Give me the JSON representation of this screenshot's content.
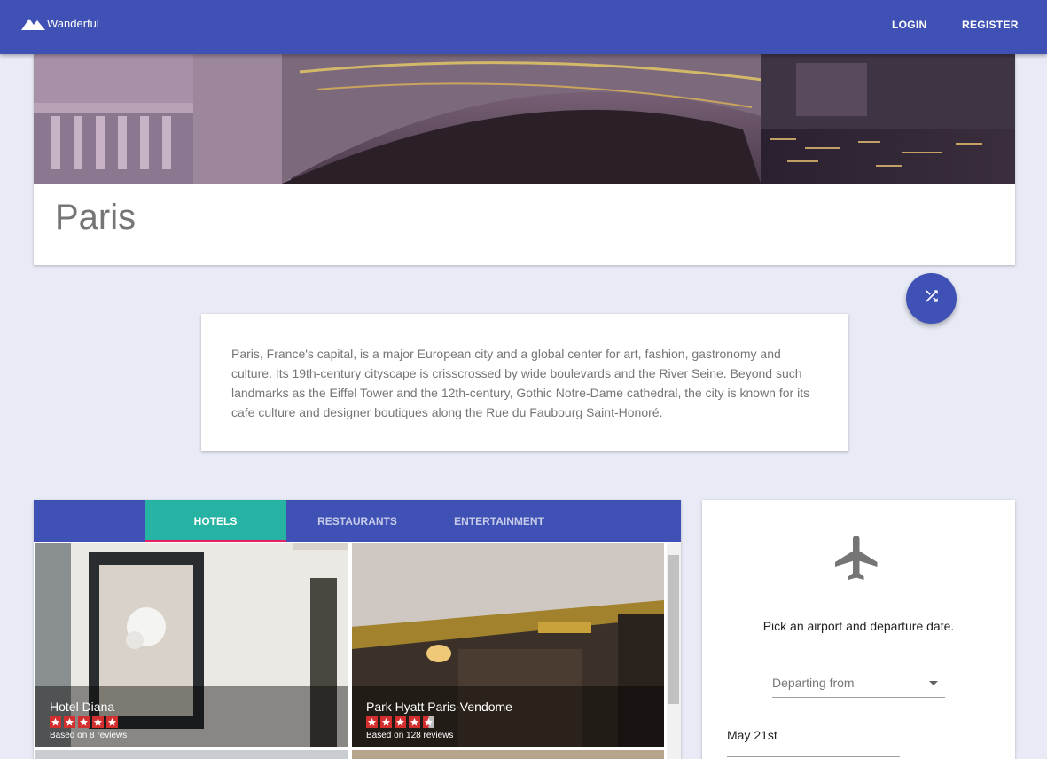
{
  "app": {
    "name": "Wanderful",
    "logo_icon": "mountain-icon"
  },
  "nav": {
    "login": "LOGIN",
    "register": "REGISTER"
  },
  "city": {
    "name": "Paris"
  },
  "shuffle_icon": "shuffle-icon",
  "description": "Paris, France's capital, is a major European city and a global center for art, fashion, gastronomy and culture. Its 19th-century cityscape is crisscrossed by wide boulevards and the River Seine. Beyond such landmarks as the Eiffel Tower and the 12th-century, Gothic Notre-Dame cathedral, the city is known for its cafe culture and designer boutiques along the Rue du Faubourg Saint-Honoré.",
  "tabs": [
    {
      "label": "HOTELS",
      "active": true
    },
    {
      "label": "RESTAURANTS",
      "active": false
    },
    {
      "label": "ENTERTAINMENT",
      "active": false
    }
  ],
  "hotels": [
    {
      "name": "Hotel Diana",
      "rating": 5,
      "reviews": "Based on 8 reviews"
    },
    {
      "name": "Park Hyatt Paris-Vendome",
      "rating": 4.5,
      "reviews": "Based on 128 reviews"
    }
  ],
  "flight": {
    "icon": "airplane-icon",
    "prompt": "Pick an airport and departure date.",
    "airport_placeholder": "Departing from",
    "date": "May 21st"
  },
  "colors": {
    "primary": "#3f51b5",
    "accent": "#26b3a3",
    "indicator": "#e91e63",
    "star": "#d32f2f",
    "background": "#e8eaf6"
  }
}
